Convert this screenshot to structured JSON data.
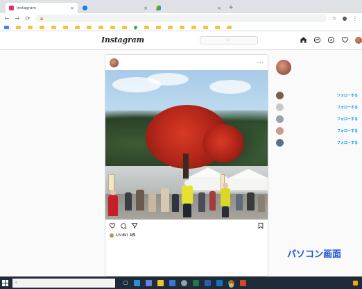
{
  "browser": {
    "tabs": [
      {
        "title": "Instagram",
        "favicon_color": "#e1306c",
        "active": true
      },
      {
        "title": "",
        "favicon_color": "#1877f2",
        "active": false
      },
      {
        "title": "",
        "favicon_color": "#34a853",
        "active": false
      }
    ],
    "tab_close_glyph": "×",
    "new_tab_glyph": "+",
    "url": "",
    "bookmarks": [
      "",
      "",
      "",
      "",
      "",
      "",
      "",
      "",
      "",
      "",
      "",
      "",
      "",
      "",
      "",
      "",
      "",
      "",
      "",
      ""
    ]
  },
  "instagram": {
    "logo": "Instagram",
    "search_placeholder": "",
    "nav_icons": [
      "home-icon",
      "messenger-icon",
      "explore-icon",
      "heart-icon",
      "profile-avatar"
    ]
  },
  "post": {
    "username": "",
    "more_glyph": "···",
    "likes": "いいね！1件",
    "caption_lines": [
      {
        "user": "",
        "text": ""
      },
      {
        "user": "",
        "text": ""
      },
      {
        "user": "",
        "text": ""
      },
      {
        "user": "",
        "text": ""
      }
    ],
    "photo_alt": ""
  },
  "sidebar": {
    "me": {
      "username": "",
      "name": "",
      "switch_label": ""
    },
    "suggestions_title": "",
    "see_all": "",
    "suggestions": [
      {
        "username": "",
        "sub": "",
        "follow": "フォローする",
        "avatar_color": "#7a5c4a"
      },
      {
        "username": "",
        "sub": "",
        "follow": "フォローする",
        "avatar_color": "#c9c9c9"
      },
      {
        "username": "",
        "sub": "",
        "follow": "フォローする",
        "avatar_color": "#9aa3a8"
      },
      {
        "username": "",
        "sub": "",
        "follow": "フォローする",
        "avatar_color": "#c99a8a"
      },
      {
        "username": "",
        "sub": "",
        "follow": "フォローする",
        "avatar_color": "#5a6f8a"
      }
    ],
    "footer": "",
    "copyright": ""
  },
  "overlay": {
    "caption": "パソコン画面"
  },
  "taskbar": {
    "search_placeholder": "",
    "tray_text": ""
  },
  "colors": {
    "link_blue": "#0095f6",
    "overlay_blue": "#1a52d6",
    "tree_red": "#c8301f"
  }
}
